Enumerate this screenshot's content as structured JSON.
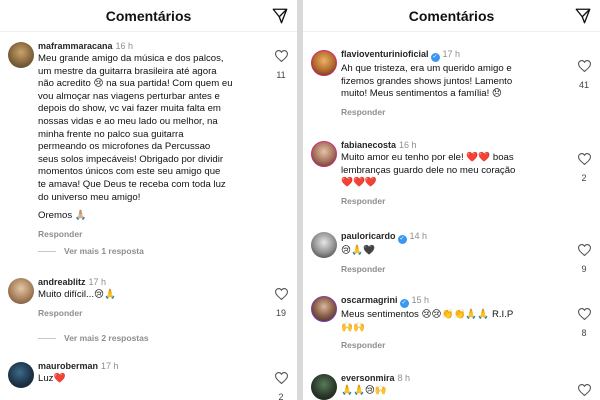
{
  "header": {
    "title": "Comentários"
  },
  "left_comments": [
    {
      "user": "maframmaracana",
      "time": "16 h",
      "lines": [
        "Meu grande amigo da música e dos palcos,",
        "um mestre da guitarra brasileira até agora",
        "não acredito 😢 na sua partida! Com quem eu",
        "vou almoçar nas viagens perturbar antes e",
        "depois do show, vc vai fazer muita falta em",
        "nossas vidas e ao meu lado ou melhor, na",
        "minha frente no palco sua guitarra",
        "permeando os microfones da Percussao",
        "seus solos impecáveis! Obrigado por dividir",
        "momentos únicos com este seu amigo que",
        "te amava! Que Deus te receba com toda luz",
        "do universo meu amigo!",
        "",
        "Oremos 🙏🏼"
      ],
      "reply_label": "Responder",
      "likes": "11",
      "more_label": "Ver mais 1 resposta"
    },
    {
      "user": "andreablitz",
      "time": "17 h",
      "lines": [
        "Muito difícil...😢🙏"
      ],
      "reply_label": "Responder",
      "likes": "19",
      "more_label": "Ver mais 2 respostas"
    },
    {
      "user": "mauroberman",
      "time": "17 h",
      "lines": [
        "Luz❤️"
      ],
      "likes": "2"
    }
  ],
  "right_comments": [
    {
      "user": "flavioventurinioficial",
      "time": "17 h",
      "verified": true,
      "lines": [
        "Ah que tristeza, era um querido amigo e",
        "fizemos grandes shows juntos! Lamento",
        "muito! Meus sentimentos a família! 😞"
      ],
      "reply_label": "Responder",
      "likes": "41"
    },
    {
      "user": "fabianecosta",
      "time": "16 h",
      "verified": false,
      "lines": [
        "Muito amor eu tenho por ele! ❤️❤️ boas",
        "lembranças guardo dele no meu coração",
        "❤️❤️❤️"
      ],
      "reply_label": "Responder",
      "likes": "2"
    },
    {
      "user": "pauloricardo",
      "time": "14 h",
      "verified": true,
      "lines": [
        "😢🙏🖤"
      ],
      "reply_label": "Responder",
      "likes": "9"
    },
    {
      "user": "oscarmagrini",
      "time": "15 h",
      "verified": true,
      "lines": [
        "Meus sentimentos 😢😢👏👏🙏🙏 R.I.P",
        "🙌🙌"
      ],
      "reply_label": "Responder",
      "likes": "8"
    },
    {
      "user": "eversonmira",
      "time": "8 h",
      "verified": false,
      "lines": [
        "🙏🙏😢🙌"
      ],
      "likes": ""
    }
  ],
  "colors": {
    "link_blue": "#3897f0",
    "muted": "#8e8e8e",
    "heart_red": "#e0183b"
  },
  "icons": {
    "share": "paper-plane-icon",
    "like": "heart-outline-icon",
    "verified": "verified-badge-icon"
  }
}
